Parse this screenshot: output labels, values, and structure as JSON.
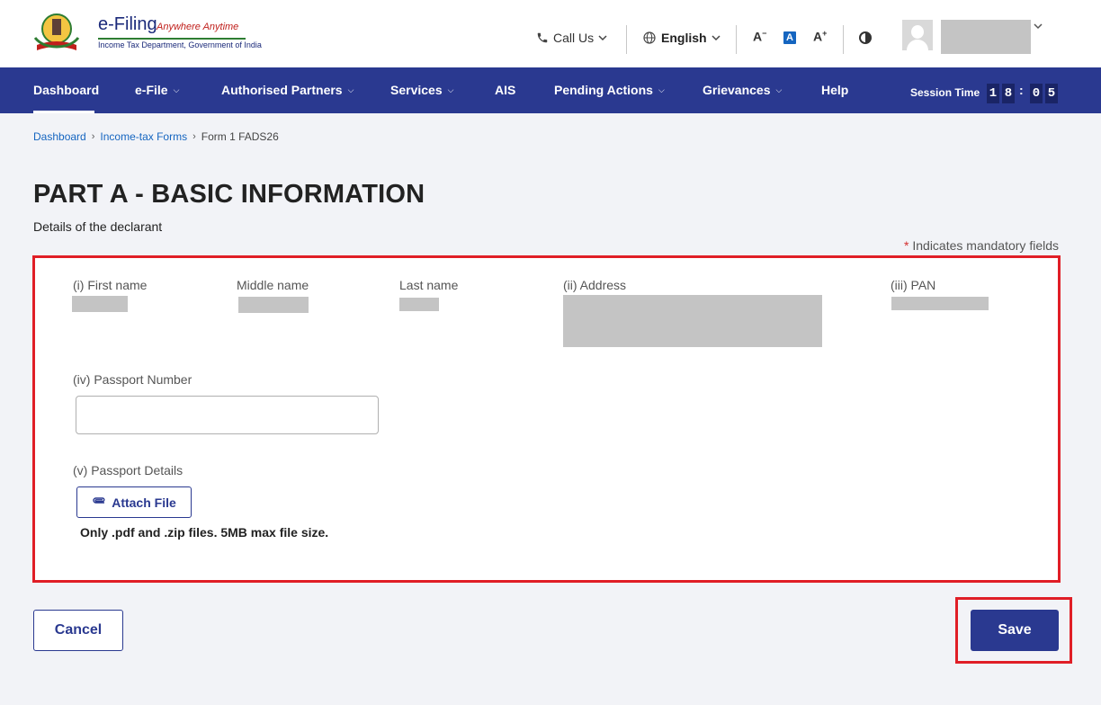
{
  "header": {
    "logo_title": "e-Filing",
    "logo_tagline": "Anywhere Anytime",
    "logo_subtitle": "Income Tax Department, Government of India",
    "call_us": "Call Us",
    "language": "English",
    "font_decrease": "A",
    "font_normal": "A",
    "font_increase": "A"
  },
  "nav": {
    "items": [
      {
        "label": "Dashboard",
        "active": true
      },
      {
        "label": "e-File"
      },
      {
        "label": "Authorised Partners"
      },
      {
        "label": "Services"
      },
      {
        "label": "AIS"
      },
      {
        "label": "Pending Actions"
      },
      {
        "label": "Grievances"
      },
      {
        "label": "Help"
      }
    ],
    "session_label": "Session Time",
    "session_digits": [
      "1",
      "8",
      "0",
      "5"
    ]
  },
  "breadcrumb": {
    "items": [
      "Dashboard",
      "Income-tax Forms"
    ],
    "current": "Form 1 FADS26"
  },
  "page": {
    "title": "PART A - BASIC INFORMATION",
    "subtitle": "Details of the declarant",
    "mandatory_star": "*",
    "mandatory_text": "Indicates mandatory fields"
  },
  "form": {
    "first_name_label": "(i) First name",
    "middle_name_label": "Middle name",
    "last_name_label": "Last name",
    "address_label": "(ii) Address",
    "pan_label": "(iii) PAN",
    "passport_number_label": "(iv) Passport Number",
    "passport_number_value": "",
    "passport_details_label": "(v) Passport Details",
    "attach_label": "Attach File",
    "file_note": "Only .pdf and .zip files. 5MB max file size."
  },
  "actions": {
    "cancel": "Cancel",
    "save": "Save"
  },
  "colors": {
    "primary": "#2a3990",
    "highlight": "#e01e26",
    "link": "#1565c0"
  }
}
